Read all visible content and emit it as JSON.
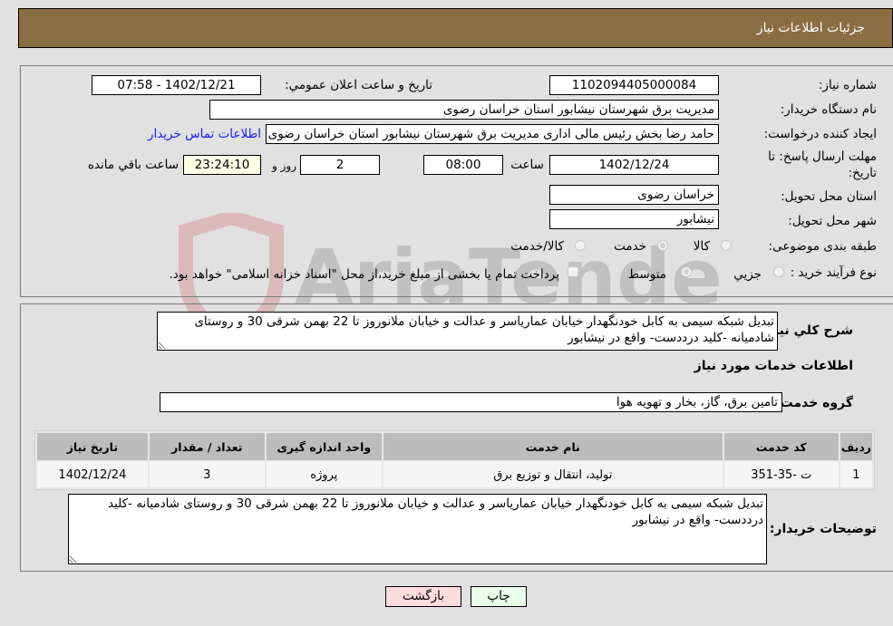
{
  "header": {
    "title": "جزئیات اطلاعات نیاز"
  },
  "form": {
    "need_number": {
      "label": "شماره نیاز:",
      "value": "1102094405000084"
    },
    "announce_datetime": {
      "label": "تاریخ و ساعت اعلان عمومي:",
      "value": "1402/12/21 - 07:58"
    },
    "buyer_org": {
      "label": "نام دستگاه خریدار:",
      "value": "مدیریت برق شهرستان نیشابور استان خراسان رضوی"
    },
    "requester": {
      "label": "ایجاد کننده درخواست:",
      "value": "حامد رضا بخش رئیس مالی اداری مدیریت برق شهرستان نیشابور استان خراسان رضوی",
      "contact_link": "اطلاعات تماس خریدار"
    },
    "deadline": {
      "label_line1": "مهلت ارسال پاسخ: تا",
      "label_line2": "تاریخ:",
      "date": "1402/12/24",
      "time_label": "ساعت",
      "time": "08:00",
      "days": "2",
      "days_label": "روز و",
      "remaining": "23:24:10",
      "remaining_label": "ساعت باقي مانده"
    },
    "delivery_province": {
      "label": "استان محل تحویل:",
      "value": "خراسان رضوی"
    },
    "delivery_city": {
      "label": "شهر محل تحویل:",
      "value": "نیشابور"
    },
    "category": {
      "label": "طبقه بندی موضوعی:",
      "options": [
        "کالا",
        "خدمت",
        "کالا/خدمت"
      ],
      "selected": "خدمت"
    },
    "purchase_type": {
      "label": "نوع فرآیند خرید :",
      "options": [
        "جزیي",
        "متوسط"
      ],
      "selected": "متوسط",
      "treasury_note": "پرداخت تمام یا بخشی از مبلغ خرید،از محل \"اسناد خزانه اسلامی\" خواهد بود."
    }
  },
  "details": {
    "description_label": "شرح کلي نیاز:",
    "description": "تبدیل شبکه سیمی به کابل خودنگهدار خیابان عمارياسر و عدالت و خیابان ملانوروز تا 22 بهمن شرقی 30 و روستای شادمیانه -کلید درددست- واقع در نیشابور",
    "services_heading": "اطلاعات خدمات مورد نیاز",
    "service_group_label": "گروه خدمت:",
    "service_group": "تامین برق، گاز، بخار و تهویه هوا",
    "table": {
      "headers": [
        "ردیف",
        "کد خدمت",
        "نام خدمت",
        "واحد اندازه گیری",
        "تعداد / مقدار",
        "تاریخ نیاز"
      ],
      "rows": [
        [
          "1",
          "ت -35-351",
          "تولید، انتقال و توزیع برق",
          "پروژه",
          "3",
          "1402/12/24"
        ]
      ]
    },
    "buyer_notes_label": "توضیحات خریدار:",
    "buyer_notes": "تبدیل شبکه سیمی به کابل خودنگهدار خیابان عمارياسر و عدالت و خیابان ملانوروز تا 22 بهمن شرقی 30 و روستای شادمیانه -کلید درددست- واقع در نیشابور"
  },
  "buttons": {
    "print": "چاپ",
    "back": "بازگشت"
  },
  "watermark": {
    "text": "AriaTender.neT"
  },
  "colors": {
    "header_bg": "#8b6d42",
    "print_bg": "#eaffea",
    "back_bg": "#ffdddd",
    "link": "#1a1aff"
  }
}
